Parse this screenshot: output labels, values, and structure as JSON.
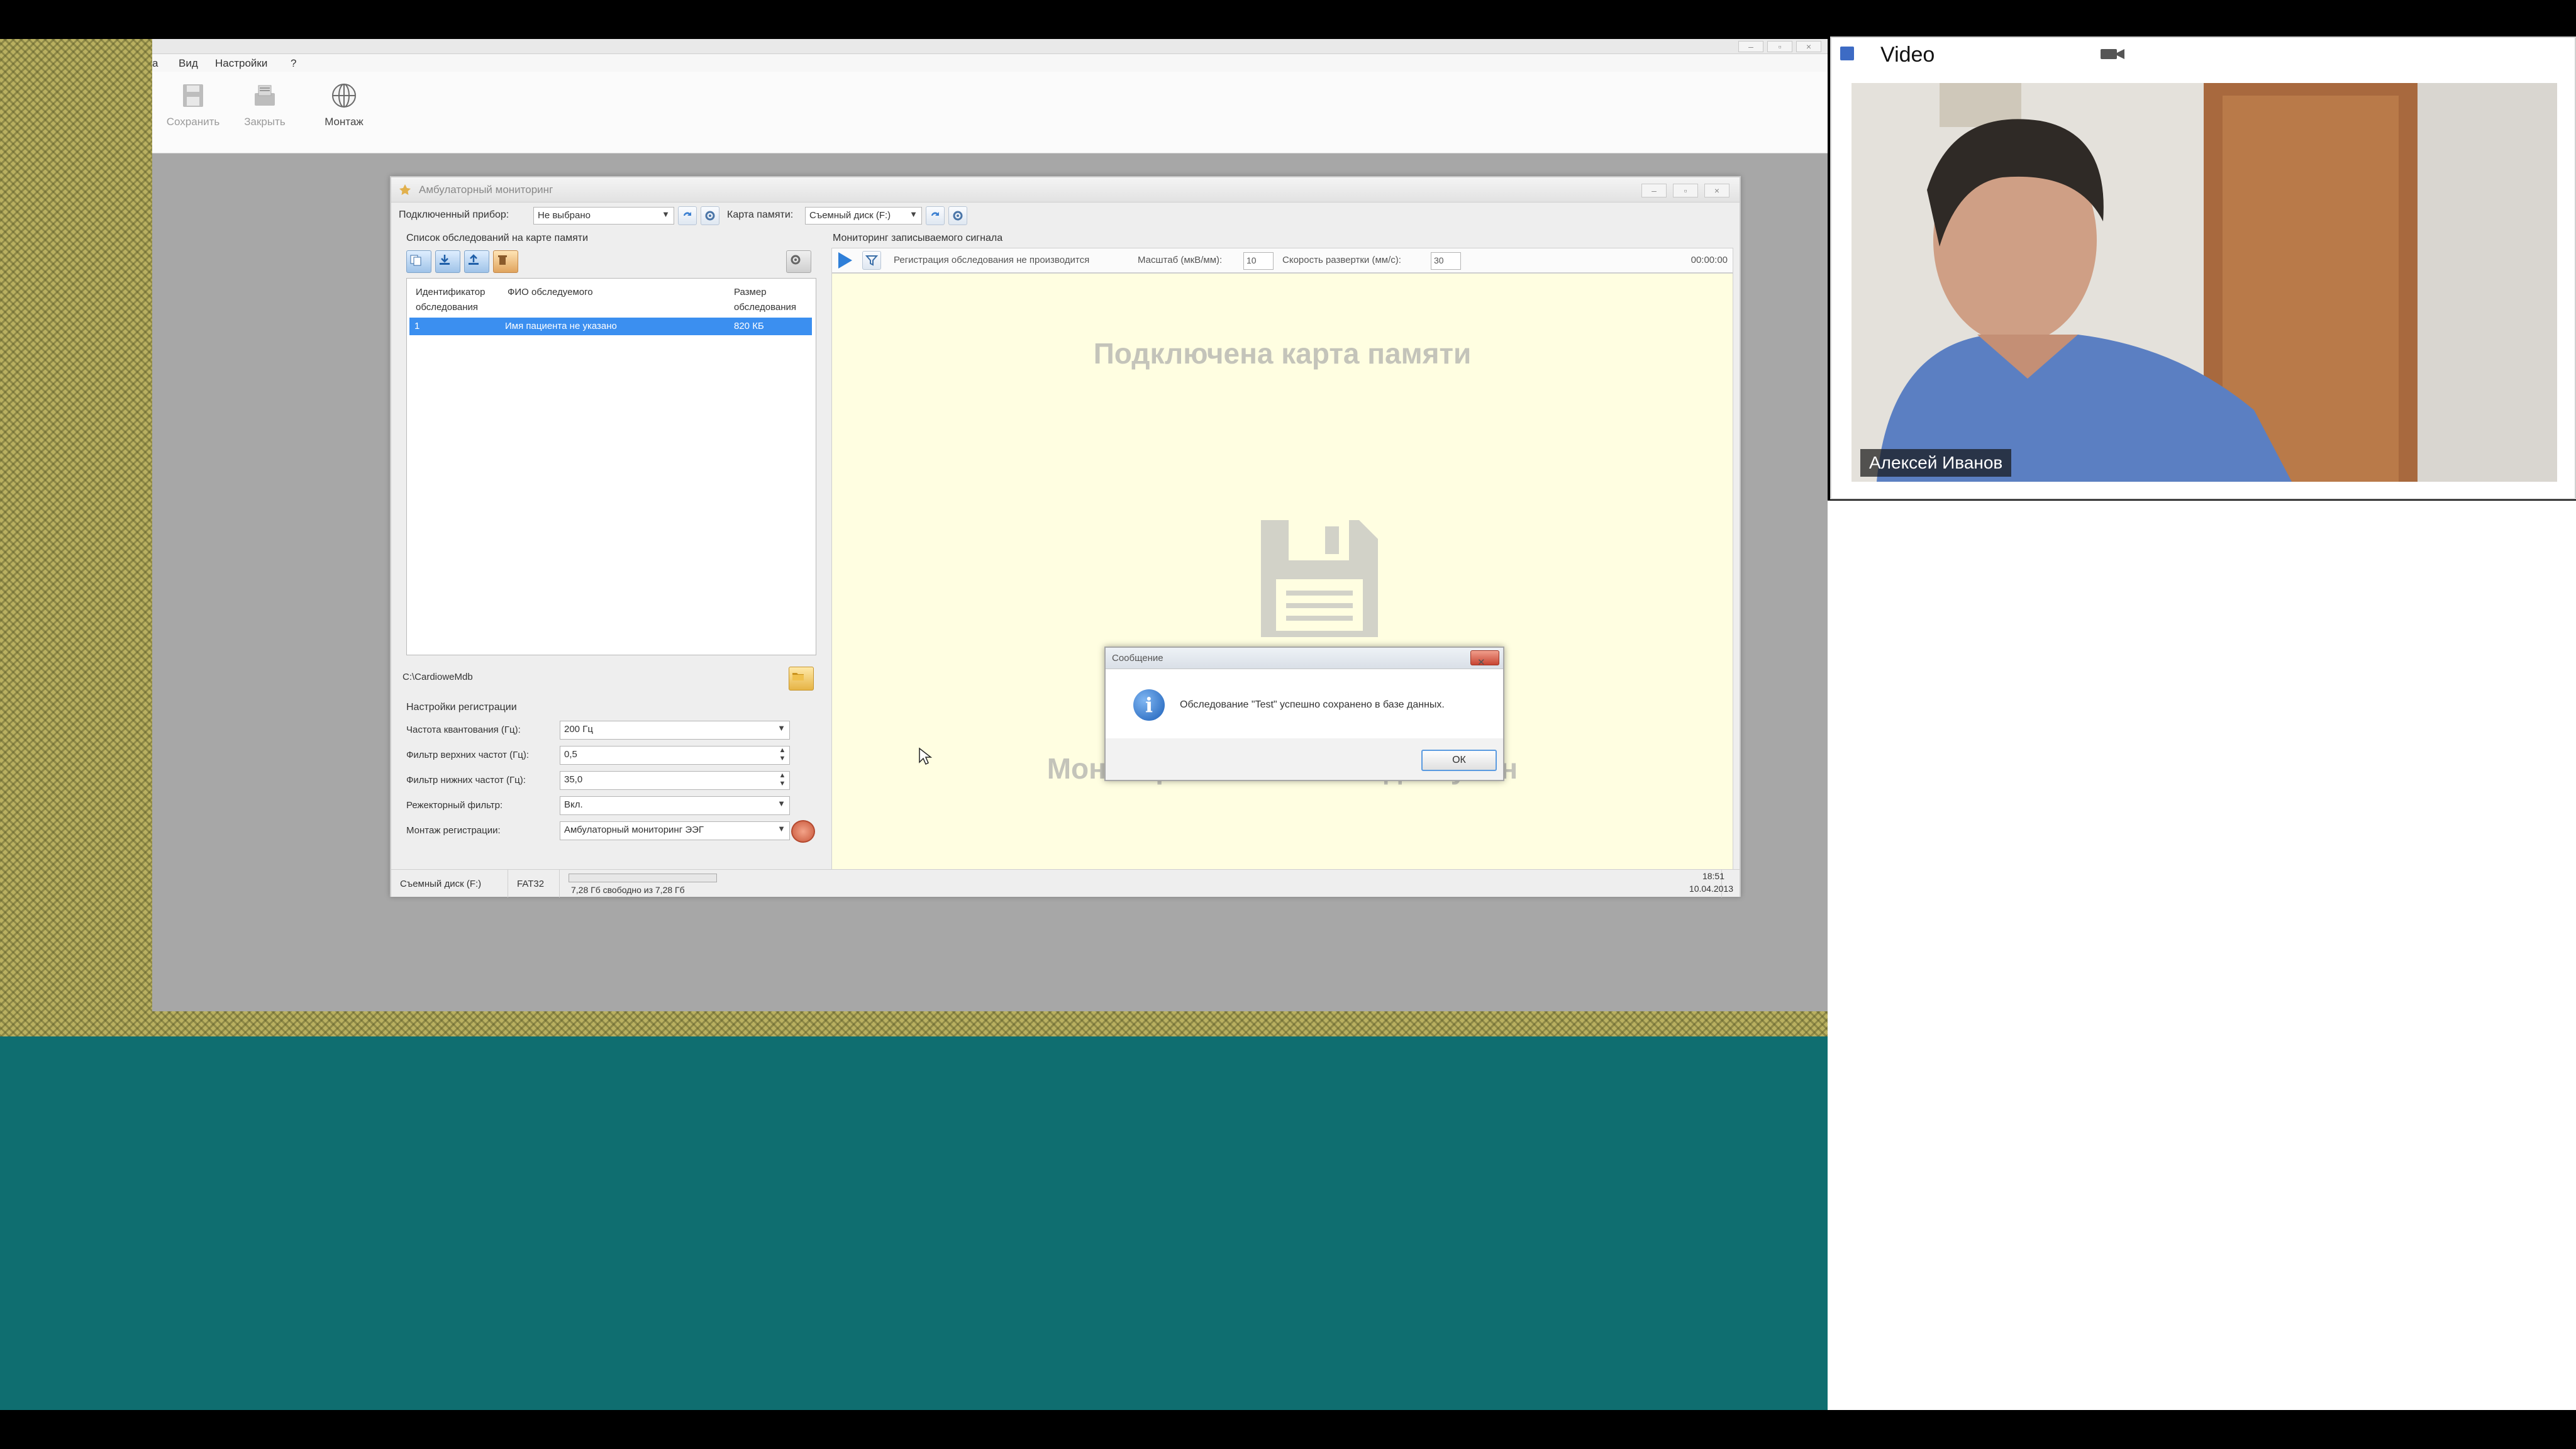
{
  "host": {
    "menu": [
      "a",
      "Вид",
      "Настройки",
      "?"
    ],
    "ribbon": [
      {
        "label": "Сохранить",
        "icon": "save-icon"
      },
      {
        "label": "Закрыть",
        "icon": "close-doc-icon"
      },
      {
        "label": "Монтаж",
        "icon": "montage-icon"
      }
    ]
  },
  "app": {
    "title": "Амбулаторный мониторинг",
    "toolbar": {
      "device_label": "Подключенный прибор:",
      "device_value": "Не выбрано",
      "card_label": "Карта памяти:",
      "card_value": "Съемный диск (F:)"
    },
    "file_list": {
      "title": "Список обследований на карте памяти",
      "columns": [
        "Идентификатор обследования",
        "ФИО обследуемого",
        "Размер обследования"
      ],
      "rows": [
        {
          "id": "1",
          "name": "Имя пациента не указано",
          "size": "820 КБ"
        }
      ]
    },
    "db_path": "C:\\CardioweMdb",
    "settings": {
      "title": "Настройки регистрации",
      "rows": [
        {
          "name": "Частота квантования (Гц):",
          "value": "200 Гц"
        },
        {
          "name": "Фильтр верхних частот (Гц):",
          "value": "0,5"
        },
        {
          "name": "Фильтр нижних частот (Гц):",
          "value": "35,0"
        },
        {
          "name": "Режекторный фильтр:",
          "value": "Вкл."
        },
        {
          "name": "Монтаж регистрации:",
          "value": "Амбулаторный мониторинг ЭЭГ"
        }
      ]
    },
    "monitor": {
      "title": "Мониторинг записываемого сигнала",
      "status": "Регистрация обследования не производится",
      "scale_label": "Масштаб (мкВ/мм):",
      "scale_value": "10",
      "speed_label": "Скорость развертки (мм/с):",
      "speed_value": "30",
      "time": "00:00:00",
      "connected": "Подключена карта памяти",
      "unavailable": "Мониторинг сигнала недоступен"
    },
    "dialog": {
      "title": "Сообщение",
      "message": "Обследование \"Test\" успешно сохранено в базе данных.",
      "ok": "ОК"
    },
    "status": {
      "disk": "Съемный диск (F:)",
      "fs": "FAT32",
      "free": "7,28 Гб свободно из 7,28 Гб",
      "progress": 0.0,
      "time": "18:51",
      "date": "10.04.2013"
    }
  },
  "video": {
    "title": "Video",
    "participant": "Алексей Иванов"
  }
}
